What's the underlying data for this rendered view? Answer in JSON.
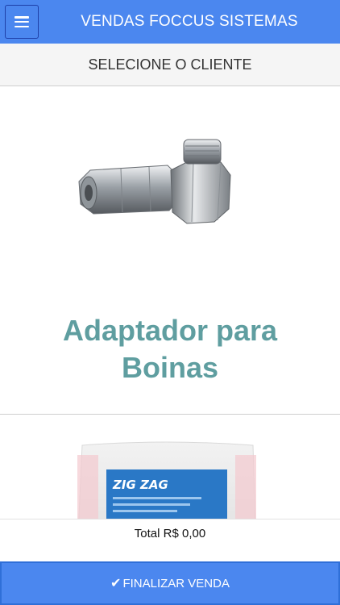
{
  "header": {
    "title": "VENDAS FOCCUS SISTEMAS",
    "menu_icon": "hamburger-menu-icon"
  },
  "client_selector": {
    "label": "SELECIONE O CLIENTE"
  },
  "products": [
    {
      "name": "Adaptador para Boinas",
      "image": "adapter-nut-image"
    },
    {
      "name": "",
      "image": "zig-zag-package-image",
      "image_text": "ZIG ZAG"
    }
  ],
  "total": {
    "text": "Total R$ 0,00"
  },
  "finalize_button": {
    "icon": "check-icon",
    "label": "FINALIZAR VENDA"
  },
  "colors": {
    "primary": "#4b87ef",
    "product_name": "#5f9ea0"
  }
}
